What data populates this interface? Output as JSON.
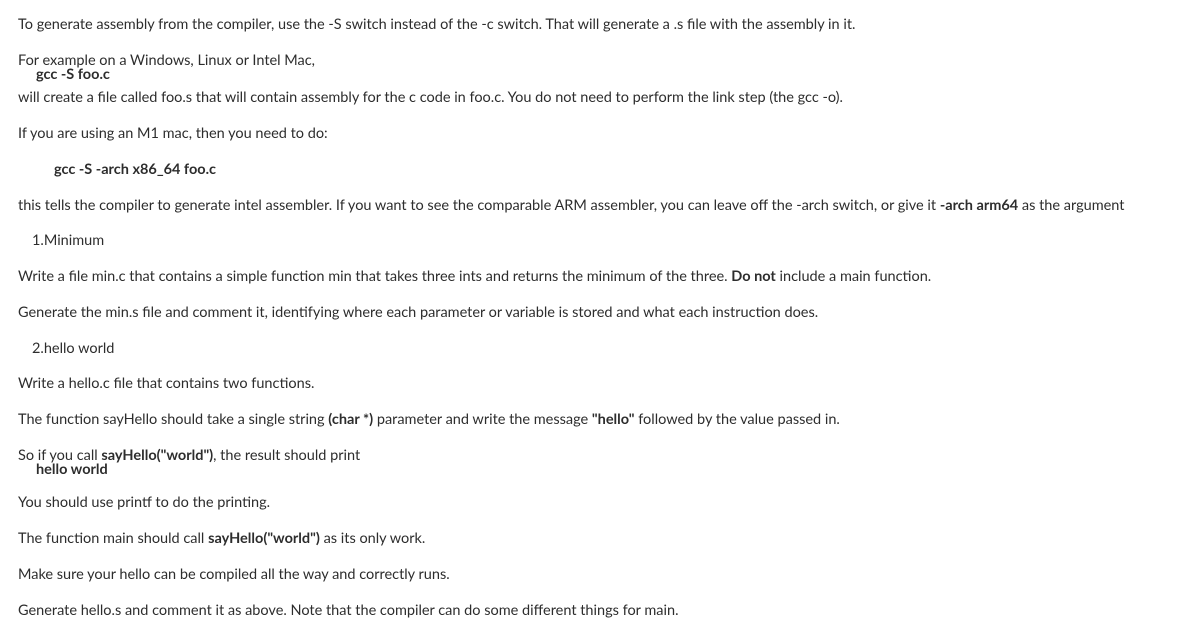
{
  "p1": "To generate assembly from the compiler, use the -S switch instead of the -c switch. That will generate a .s file with the assembly in it.",
  "p2": "For example on a Windows, Linux or Intel Mac,",
  "p3": "gcc -S foo.c",
  "p4": "will create a file called foo.s that will contain assembly for the c code in foo.c.  You do not need to perform the link step (the gcc -o).",
  "p5": "If you are using an M1 mac, then you need to do:",
  "p6": "gcc -S -arch x86_64 foo.c",
  "p7a": "this tells the compiler to generate intel assembler.  If you want to see the comparable ARM assembler, you can leave off the -arch switch, or give it ",
  "p7b": "-arch arm64",
  "p7c": " as the argument",
  "item1_num": "1.  ",
  "item1_title": "Minimum",
  "p8a": "Write a file min.c that contains a simple function min that takes three ints and returns the minimum of the three. ",
  "p8b": "Do not",
  "p8c": " include a main function.",
  "p9": "Generate the min.s file and comment it, identifying where each parameter or variable is stored and what each instruction does.",
  "item2_num": "2.  ",
  "item2_title": "hello world",
  "p10": "Write a hello.c file that contains two functions.",
  "p11a": "The function sayHello should take a single string ",
  "p11b": "(char *)",
  "p11c": " parameter and write the message ",
  "p11d": "\"hello\"",
  "p11e": " followed by the value passed in.",
  "p12a": "So if you call ",
  "p12b": "sayHello(\"world\")",
  "p12c": ", the result should print",
  "p13": "hello world",
  "p14": "You should use printf to do the printing.",
  "p15a": "The function main should call ",
  "p15b": "sayHello(\"world\")",
  "p15c": " as its only work.",
  "p16": "Make sure your hello can be compiled all the way and correctly runs.",
  "p17": "Generate hello.s and comment it as above. Note that the compiler can do some different things for main."
}
